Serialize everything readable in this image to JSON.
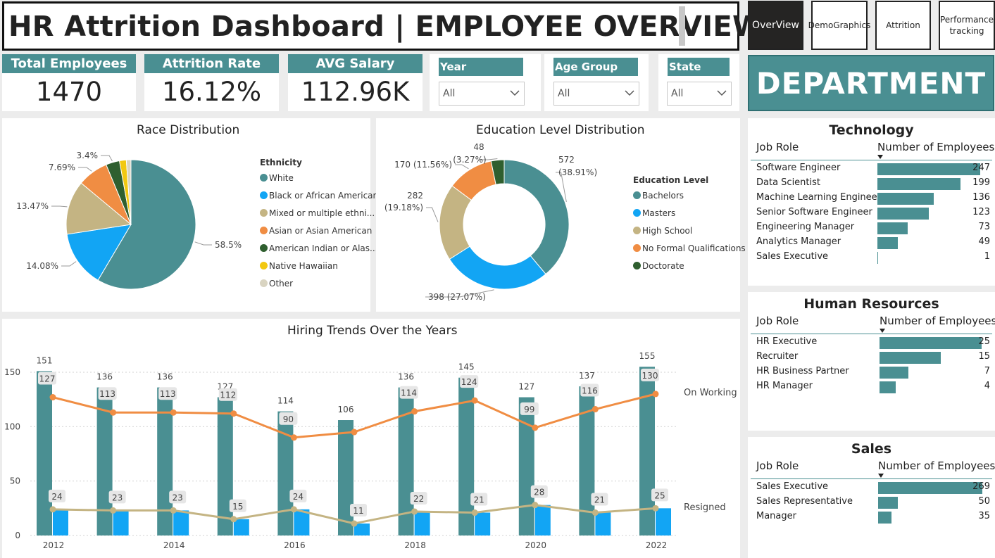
{
  "header": {
    "title": "HR Attrition Dashboard  | EMPLOYEE OVERVIEW"
  },
  "nav": {
    "overview": "OverView",
    "demographics": "DemoGraphics",
    "attrition": "Attrition",
    "performance_line1": "Performance",
    "performance_line2": "tracking"
  },
  "kpis": {
    "total_employees_label": "Total Employees",
    "total_employees_value": "1470",
    "attrition_rate_label": "Attrition Rate",
    "attrition_rate_value": "16.12%",
    "avg_salary_label": "AVG Salary",
    "avg_salary_value": "112.96K"
  },
  "filters": {
    "year_label": "Year",
    "year_value": "All",
    "age_group_label": "Age Group",
    "age_group_value": "All",
    "state_label": "State",
    "state_value": "All"
  },
  "department_banner": "DEPARTMENT",
  "colors": {
    "teal": "#4a8f92",
    "blue": "#12a5f4",
    "tan": "#c4b483",
    "orange": "#f08d43",
    "darkgreen": "#2f5f2f",
    "yellow": "#f2c811",
    "lightgray": "#d9d4c1"
  },
  "chart_data": [
    {
      "type": "pie",
      "title": "Race Distribution",
      "legend_title": "Ethnicity",
      "legend_placement": "right",
      "categories": [
        "White",
        "Black or African American",
        "Mixed or multiple ethni...",
        "Asian or Asian American",
        "American Indian or Alas...",
        "Native Hawaiian",
        "Other"
      ],
      "values": [
        58.5,
        14.08,
        13.47,
        7.69,
        3.4,
        1.7,
        1.16
      ],
      "data_labels": [
        "58.5%",
        "14.08%",
        "13.47%",
        "7.69%",
        "3.4%",
        "",
        ""
      ],
      "colors": [
        "#4a8f92",
        "#12a5f4",
        "#c4b483",
        "#f08d43",
        "#2f5f2f",
        "#f2c811",
        "#d9d4c1"
      ]
    },
    {
      "type": "pie",
      "subtype": "donut",
      "title": "Education Level Distribution",
      "legend_title": "Education Level",
      "legend_placement": "right",
      "categories": [
        "Bachelors",
        "Masters",
        "High School",
        "No Formal Qualifications",
        "Doctorate"
      ],
      "values": [
        572,
        398,
        282,
        170,
        48
      ],
      "percents": [
        "38.91%",
        "27.07%",
        "19.18%",
        "11.56%",
        "3.27%"
      ],
      "colors": [
        "#4a8f92",
        "#12a5f4",
        "#c4b483",
        "#f08d43",
        "#2f5f2f"
      ]
    },
    {
      "type": "bar",
      "title": "Hiring Trends Over the Years",
      "x": [
        2012,
        2013,
        2014,
        2015,
        2016,
        2017,
        2018,
        2019,
        2020,
        2021,
        2022
      ],
      "xticks": [
        "2012",
        "2014",
        "2016",
        "2018",
        "2020",
        "2022"
      ],
      "yticks": [
        "0",
        "50",
        "100",
        "150"
      ],
      "ylim": [
        0,
        160
      ],
      "grid": true,
      "series": [
        {
          "name": "",
          "kind": "bar",
          "color": "#4a8f92",
          "values": [
            151,
            136,
            136,
            127,
            114,
            106,
            136,
            145,
            127,
            137,
            155
          ]
        },
        {
          "name": "",
          "kind": "bar",
          "color": "#12a5f4",
          "values": [
            24,
            23,
            23,
            15,
            24,
            11,
            22,
            21,
            28,
            21,
            25
          ]
        },
        {
          "name": "On Working",
          "kind": "line",
          "color": "#f08d43",
          "values": [
            127,
            113,
            113,
            112,
            90,
            95,
            114,
            124,
            99,
            116,
            130
          ],
          "labels": [
            "127",
            "113",
            "113",
            "112",
            "90",
            "",
            "114",
            "124",
            "99",
            "116",
            "130"
          ]
        },
        {
          "name": "Resigned",
          "kind": "line",
          "color": "#c4b483",
          "values": [
            24,
            23,
            23,
            15,
            24,
            11,
            22,
            21,
            28,
            21,
            25
          ]
        }
      ]
    }
  ],
  "departments": {
    "col_role": "Job Role",
    "col_count": "Number of Employees",
    "technology": {
      "title": "Technology",
      "rows": [
        {
          "role": "Software Engineer",
          "count": 247
        },
        {
          "role": "Data Scientist",
          "count": 199
        },
        {
          "role": "Machine Learning Engineer",
          "count": 136
        },
        {
          "role": "Senior Software Engineer",
          "count": 123
        },
        {
          "role": "Engineering Manager",
          "count": 73
        },
        {
          "role": "Analytics Manager",
          "count": 49
        },
        {
          "role": "Sales Executive",
          "count": 1
        }
      ]
    },
    "hr": {
      "title": "Human Resources",
      "rows": [
        {
          "role": "HR Executive",
          "count": 25
        },
        {
          "role": "Recruiter",
          "count": 15
        },
        {
          "role": "HR Business Partner",
          "count": 7
        },
        {
          "role": "HR Manager",
          "count": 4
        }
      ]
    },
    "sales": {
      "title": "Sales",
      "rows": [
        {
          "role": "Sales Executive",
          "count": 269
        },
        {
          "role": "Sales Representative",
          "count": 50
        },
        {
          "role": "Manager",
          "count": 35
        }
      ]
    }
  }
}
